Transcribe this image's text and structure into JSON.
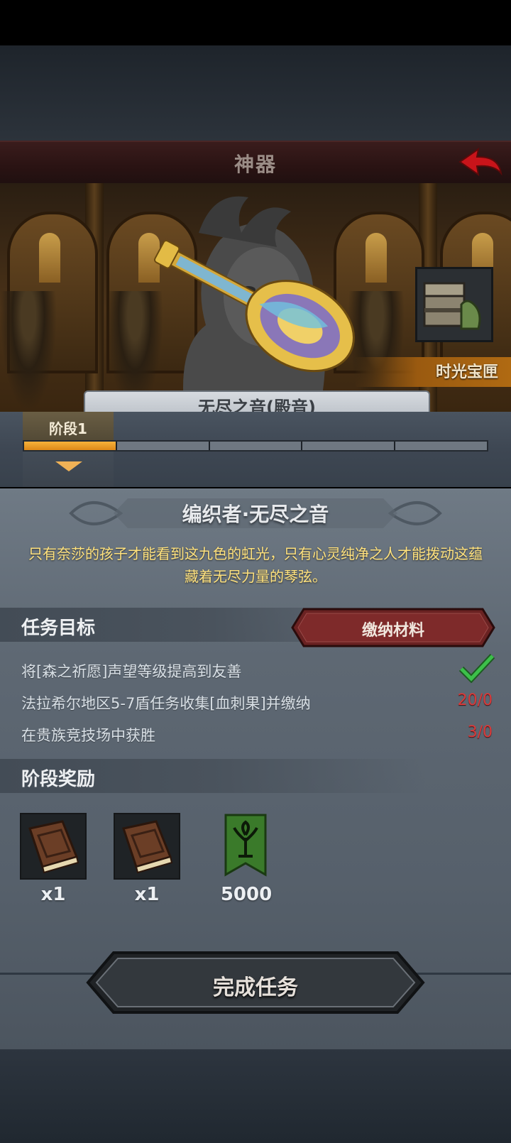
{
  "header": {
    "title": "神器"
  },
  "artifact_display": {
    "chest_label": "时光宝匣",
    "artifact_name_partial": "无尽之音(殿音)"
  },
  "stage": {
    "tab_label": "阶段1",
    "current": 1,
    "total": 5
  },
  "artifact": {
    "title": "编织者·无尽之音",
    "description": "只有奈莎的孩子才能看到这九色的虹光，只有心灵纯净之人才能拨动这蕴藏着无尽力量的琴弦。"
  },
  "tasks": {
    "header": "任务目标",
    "submit_button": "缴纳材料",
    "items": [
      {
        "text": "将[森之祈愿]声望等级提高到友善",
        "status": "done"
      },
      {
        "text": "法拉希尔地区5-7盾任务收集[血刺果]并缴纳",
        "progress": "20/0"
      },
      {
        "text": "在贵族竞技场中获胜",
        "progress": "3/0"
      }
    ]
  },
  "rewards": {
    "header": "阶段奖励",
    "items": [
      {
        "icon": "book-icon",
        "count": "x1"
      },
      {
        "icon": "book-icon",
        "count": "x1"
      },
      {
        "icon": "tree-banner-icon",
        "count": "5000"
      }
    ]
  },
  "complete_button": "完成任务",
  "colors": {
    "accent_orange": "#f0a030",
    "task_value_red": "#d83a3a",
    "check_green": "#3cc04a",
    "description_yellow": "#ffe27e"
  }
}
